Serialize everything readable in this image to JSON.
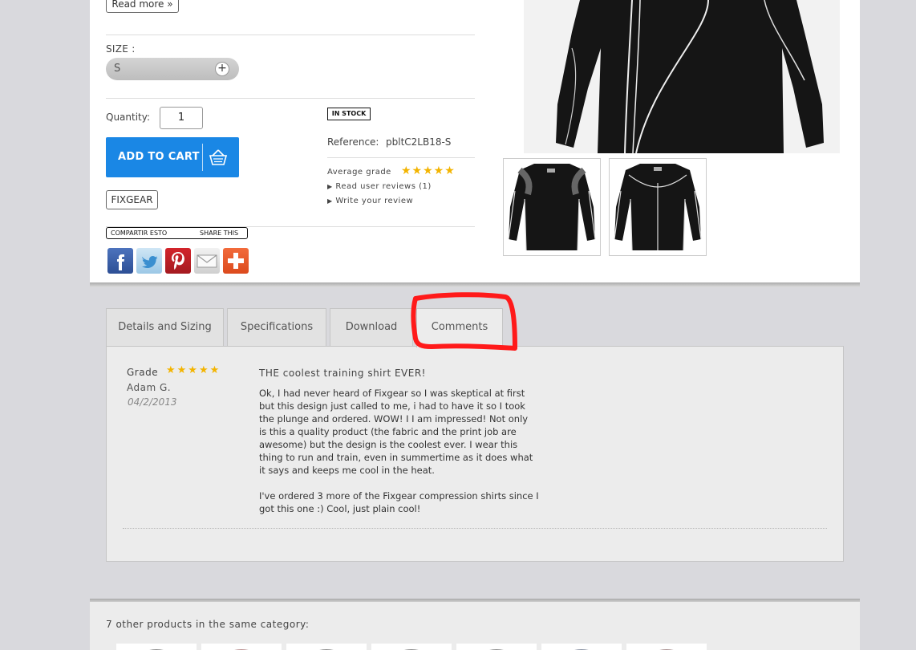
{
  "product": {
    "read_more_label": "Read more »",
    "size_label": "SIZE :",
    "size_value": "S",
    "quantity_label": "Quantity:",
    "quantity_value": "1",
    "add_to_cart_label": "ADD TO CART",
    "brand": "FIXGEAR",
    "stock_status": "IN STOCK",
    "reference_label": "Reference:",
    "reference_value": "pbltC2LB18-S",
    "average_grade_label": "Average grade",
    "average_stars": "★★★★★",
    "read_reviews_label": "Read user reviews (1)",
    "write_review_label": "Write your review"
  },
  "share": {
    "label_es": "COMPARTIR ESTO",
    "label_en": "SHARE THIS",
    "buttons": [
      "facebook-icon",
      "twitter-icon",
      "pinterest-icon",
      "mail-icon",
      "plus-icon"
    ]
  },
  "tabs": [
    {
      "label": "Details and Sizing"
    },
    {
      "label": "Specifications"
    },
    {
      "label": "Download"
    },
    {
      "label": "Comments"
    }
  ],
  "review": {
    "grade_label": "Grade",
    "stars": "★★★★★",
    "author": "Adam G.",
    "date": "04/2/2013",
    "title": "THE coolest training shirt EVER!",
    "lines": [
      "Ok, I had never heard of Fixgear so I was skeptical at first",
      "but this design just called to me, i had to have it so I took",
      "the plunge and ordered. WOW! I I am impressed! Not only",
      "is this a quality product (the fabric and the print job are",
      "awesome) but the design is the coolest ever. I wear this",
      "thing to run and train, even in summertime as it does what",
      "it says and keeps me cool in the heat.",
      "I've ordered 3 more of the Fixgear compression shirts since I",
      "got this one :) Cool, just plain cool!"
    ]
  },
  "related": {
    "title": "7 other products in the same category:"
  },
  "colors": {
    "accent": "#1a87e5",
    "stars": "#f3b400",
    "highlight": "#ff1a1a"
  }
}
